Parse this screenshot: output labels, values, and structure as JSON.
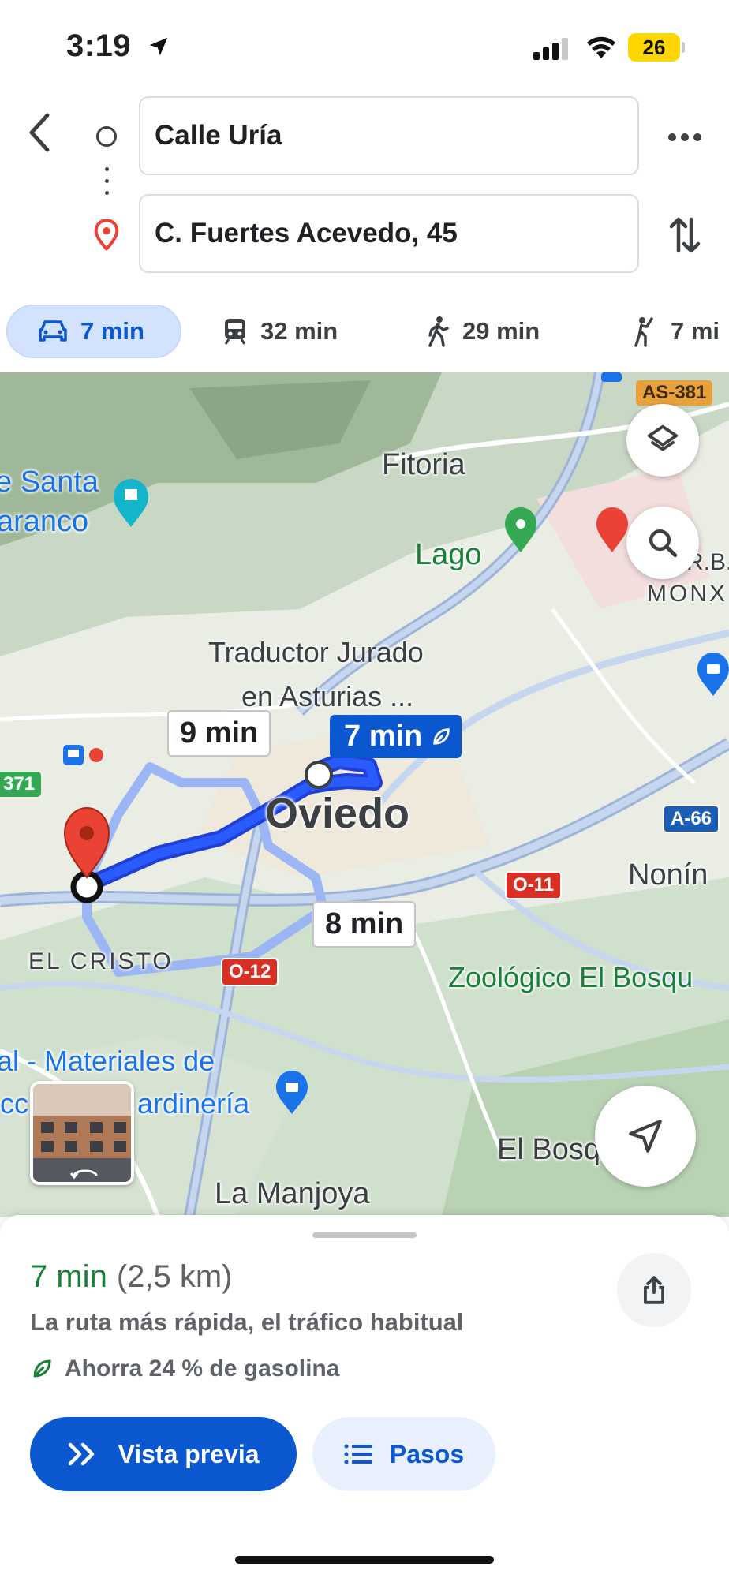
{
  "status_bar": {
    "time": "3:19",
    "battery": "26"
  },
  "route": {
    "origin": "Calle Uría",
    "destination": "C. Fuertes Acevedo, 45"
  },
  "modes": [
    {
      "name": "car",
      "label": "7 min"
    },
    {
      "name": "transit",
      "label": "32 min"
    },
    {
      "name": "walk",
      "label": "29 min"
    },
    {
      "name": "ride",
      "label": "7 mi"
    }
  ],
  "map": {
    "labels": {
      "fitoria": "Fitoria",
      "santa": "e Santa",
      "naranco": "aranco",
      "lago": "Lago",
      "monx": "MONX",
      "rb": "R.B.",
      "traductor_1": "Traductor Jurado",
      "traductor_2": "en Asturias ...",
      "oviedo": "Oviedo",
      "nonin": "Nonín",
      "el_cristo": "EL CRISTO",
      "zoologico": "Zoológico El Bosqu",
      "materiales": "al - Materiales de",
      "jardineria_pre": "cc",
      "jardineria": "ardinería",
      "el_bosque": "El Bosq",
      "la_manjoya": "La Manjoya"
    },
    "shields": {
      "as381": "AS-381",
      "a66": "A-66",
      "o11": "O-11",
      "o12": "O-12",
      "r371": "371"
    },
    "eta_labels": {
      "main": "7 min",
      "alt1": "9 min",
      "alt2": "8 min"
    }
  },
  "summary": {
    "time": "7 min",
    "distance": "(2,5 km)",
    "description": "La ruta más rápida, el tráfico habitual",
    "eco": "Ahorra 24 % de gasolina"
  },
  "buttons": {
    "preview": "Vista previa",
    "steps": "Pasos"
  },
  "colors": {
    "primary": "#0b57d0",
    "route": "#1a47e8",
    "alt_route": "#9bb5f5",
    "eco_green": "#188038",
    "pin_red": "#ea4335"
  }
}
